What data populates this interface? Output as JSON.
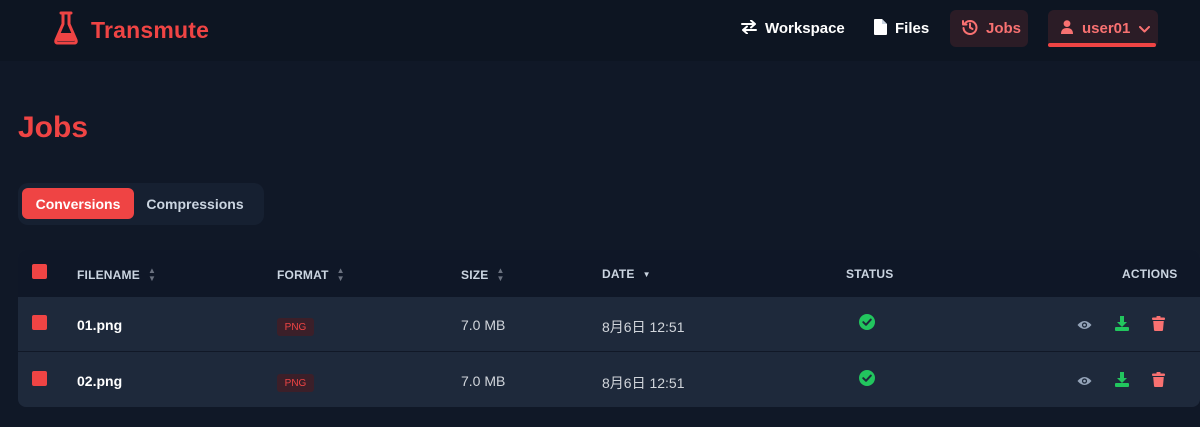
{
  "app": {
    "name": "Transmute"
  },
  "nav": {
    "workspace": "Workspace",
    "files": "Files",
    "jobs": "Jobs",
    "user": "user01"
  },
  "page": {
    "title": "Jobs"
  },
  "tabs": {
    "conversions": "Conversions",
    "compressions": "Compressions",
    "active": "Conversions"
  },
  "table": {
    "headers": {
      "filename": "FILENAME",
      "format": "FORMAT",
      "size": "SIZE",
      "date": "DATE",
      "status": "STATUS",
      "actions": "ACTIONS"
    },
    "sort": {
      "column": "DATE",
      "direction": "descending"
    },
    "rows": [
      {
        "filename": "01.png",
        "format": "PNG",
        "size": "7.0 MB",
        "date": "8月6日 12:51",
        "status": "completed",
        "status_icon": "check-circle-icon"
      },
      {
        "filename": "02.png",
        "format": "PNG",
        "size": "7.0 MB",
        "date": "8月6日 12:51",
        "status": "completed",
        "status_icon": "check-circle-icon"
      }
    ],
    "actions": [
      "view-icon",
      "download-icon",
      "delete-icon"
    ]
  },
  "colors": {
    "accent": "#ef4444",
    "background": "#101827",
    "success": "#22c55e",
    "view": "#94a3b8"
  }
}
